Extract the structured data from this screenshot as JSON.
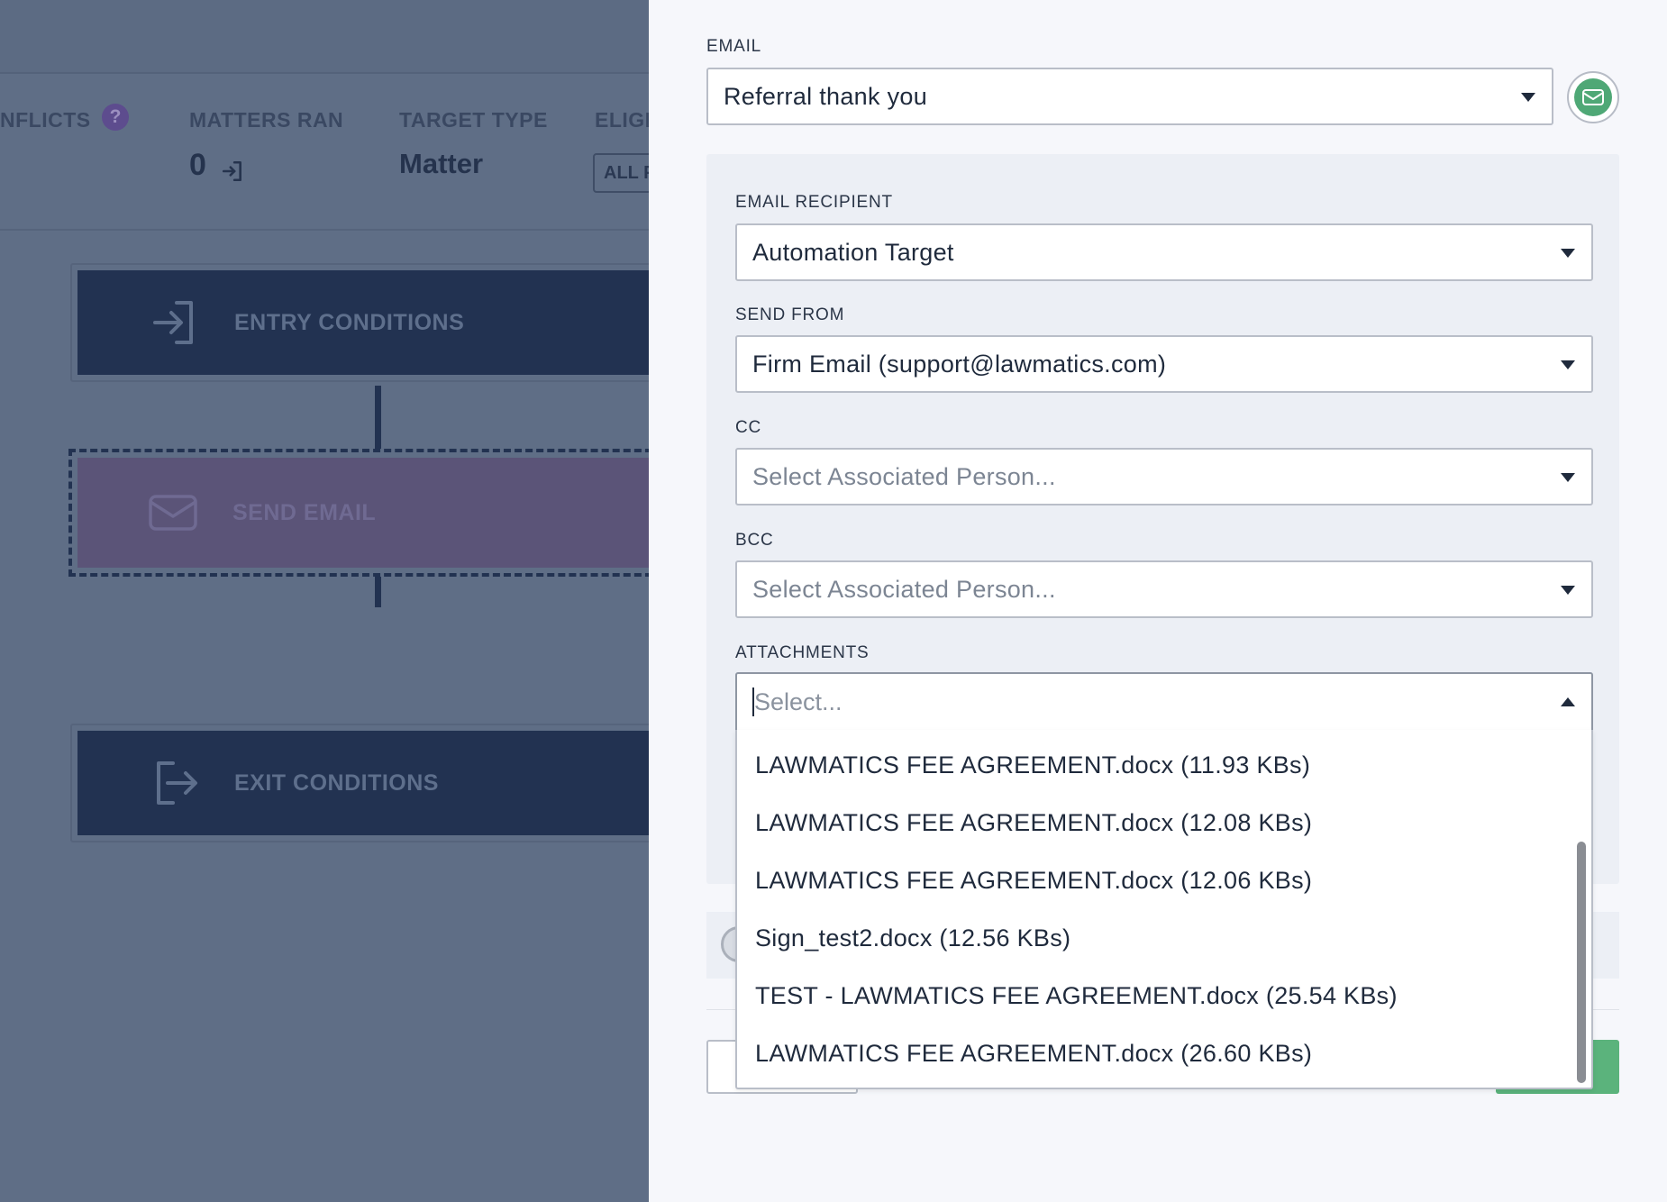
{
  "stats": {
    "conflicts_label": "NFLICTS",
    "help_glyph": "?",
    "matters_ran_label": "MATTERS RAN",
    "matters_ran_value": "0",
    "target_type_label": "TARGET TYPE",
    "target_type_value": "Matter",
    "eligible_label": "ELIGI",
    "eligible_pill": "ALL P"
  },
  "flow": {
    "entry_label": "ENTRY CONDITIONS",
    "send_email_label": "SEND EMAIL",
    "exit_label": "EXIT CONDITIONS"
  },
  "panel": {
    "email": {
      "label": "EMAIL",
      "value": "Referral thank you"
    },
    "recipient": {
      "label": "EMAIL RECIPIENT",
      "value": "Automation Target"
    },
    "send_from": {
      "label": "SEND FROM",
      "value": "Firm Email (support@lawmatics.com)"
    },
    "cc": {
      "label": "CC",
      "placeholder": "Select Associated Person..."
    },
    "bcc": {
      "label": "BCC",
      "placeholder": "Select Associated Person..."
    },
    "attachments": {
      "label": "ATTACHMENTS",
      "placeholder": "Select...",
      "options": [
        "LAWMATICS FEE AGREEMENT.docx (11.93 KBs)",
        "LAWMATICS FEE AGREEMENT.docx (12.08 KBs)",
        "LAWMATICS FEE AGREEMENT.docx (12.06 KBs)",
        "Sign_test2.docx (12.56 KBs)",
        "TEST - LAWMATICS FEE AGREEMENT.docx (25.54 KBs)",
        "LAWMATICS FEE AGREEMENT.docx (26.60 KBs)"
      ]
    }
  },
  "icons": {
    "help": "question-circle-icon",
    "enter": "enter-icon",
    "envelope": "envelope-icon",
    "exit": "exit-icon",
    "caret": "caret-down-icon"
  },
  "colors": {
    "overlay": "#5f6e86",
    "node": "#223251",
    "accent_green": "#4fa876",
    "panel_bg": "#f6f7fb"
  }
}
